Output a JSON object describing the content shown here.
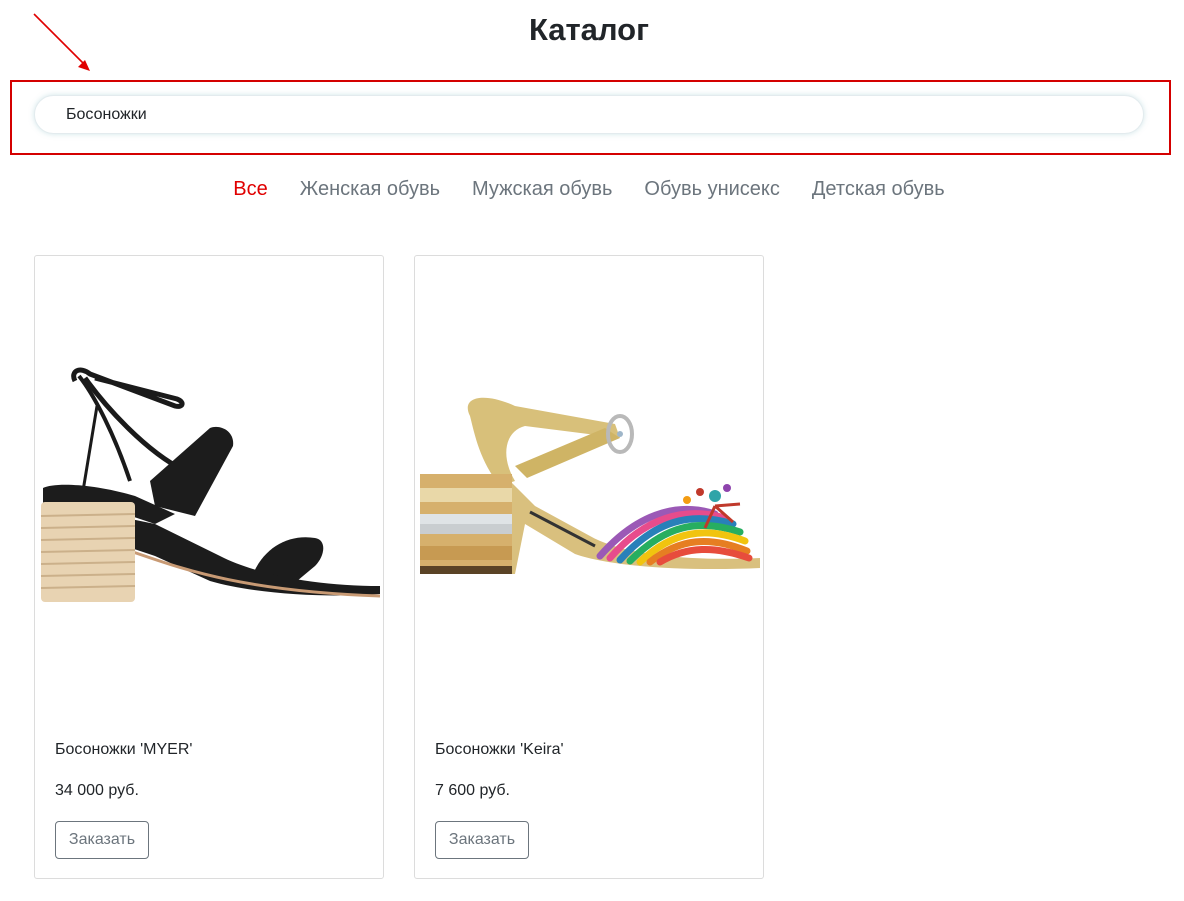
{
  "header": {
    "title": "Каталог"
  },
  "search": {
    "value": "Босоножки",
    "placeholder": ""
  },
  "categories": [
    {
      "label": "Все",
      "active": true
    },
    {
      "label": "Женская обувь",
      "active": false
    },
    {
      "label": "Мужская обувь",
      "active": false
    },
    {
      "label": "Обувь унисекс",
      "active": false
    },
    {
      "label": "Детская обувь",
      "active": false
    }
  ],
  "products": [
    {
      "name": "Босоножки 'MYER'",
      "price": "34 000 руб.",
      "button_label": "Заказать",
      "image": "black-strappy-sandal"
    },
    {
      "name": "Босоножки 'Keira'",
      "price": "7 600 руб.",
      "button_label": "Заказать",
      "image": "gold-multicolor-sandal"
    }
  ],
  "colors": {
    "accent": "#e00000",
    "highlight": "#d40000",
    "muted": "#6c757d"
  }
}
